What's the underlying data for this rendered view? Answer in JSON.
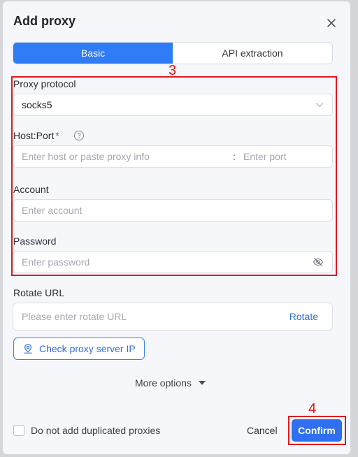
{
  "dialog": {
    "title": "Add proxy",
    "tabs": [
      {
        "label": "Basic",
        "active": true
      },
      {
        "label": "API extraction",
        "active": false
      }
    ]
  },
  "form": {
    "protocol": {
      "label": "Proxy protocol",
      "value": "socks5"
    },
    "host_port": {
      "label": "Host:Port",
      "required_mark": "*",
      "host_placeholder": "Enter host or paste proxy info",
      "separator": ":",
      "port_placeholder": "Enter port"
    },
    "account": {
      "label": "Account",
      "placeholder": "Enter account"
    },
    "password": {
      "label": "Password",
      "placeholder": "Enter password"
    },
    "rotate": {
      "label": "Rotate URL",
      "placeholder": "Please enter rotate URL",
      "action": "Rotate"
    },
    "check_button": "Check proxy server IP",
    "more_options": "More options"
  },
  "footer": {
    "no_duplicate_label": "Do not add duplicated proxies",
    "no_duplicate_checked": false,
    "cancel": "Cancel",
    "confirm": "Confirm"
  },
  "annotations": {
    "box3": "3",
    "box4": "4"
  },
  "colors": {
    "accent": "#2f7cf6",
    "annotation": "#e0181b",
    "required": "#e5322d"
  }
}
